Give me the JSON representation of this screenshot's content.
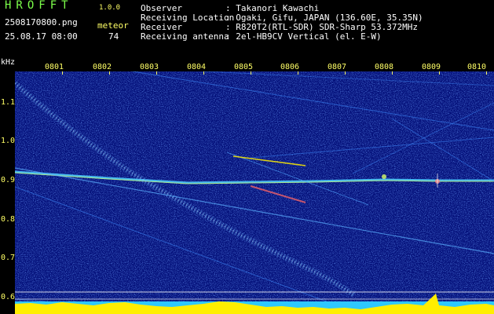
{
  "header": {
    "app_title": "HROFFT",
    "app_version": "1.0.0",
    "file_name": "2508170800.png",
    "date_time": "25.08.17 08:00",
    "meteor_label": "meteor",
    "meteor_count": "74"
  },
  "info": {
    "rows": [
      {
        "label": "Observer",
        "value": ": Takanori Kawachi"
      },
      {
        "label": "Receiving Location",
        "value": ": Ogaki, Gifu, JAPAN (136.60E, 35.35N)"
      },
      {
        "label": "Receiver",
        "value": ": R820T2(RTL-SDR) SDR-Sharp 53.372MHz"
      },
      {
        "label": "Receiving antenna",
        "value": ": 2el-HB9CV Vertical (el. E-W)"
      }
    ]
  },
  "axes": {
    "y_unit": "kHz",
    "y_ticks": [
      "1.1",
      "1.0",
      "0.9",
      "0.8",
      "0.7",
      "0.6"
    ],
    "x_ticks": [
      "0801",
      "0802",
      "0803",
      "0804",
      "0805",
      "0806",
      "0807",
      "0808",
      "0809",
      "0810"
    ]
  },
  "colors": {
    "background": "#000000",
    "plot_background": "#04107a",
    "title_green": "#7cff4a",
    "label_yellow": "#ffff66",
    "signal_cyan": "#4fd2ff",
    "signal_yellow": "#ffee00"
  }
}
